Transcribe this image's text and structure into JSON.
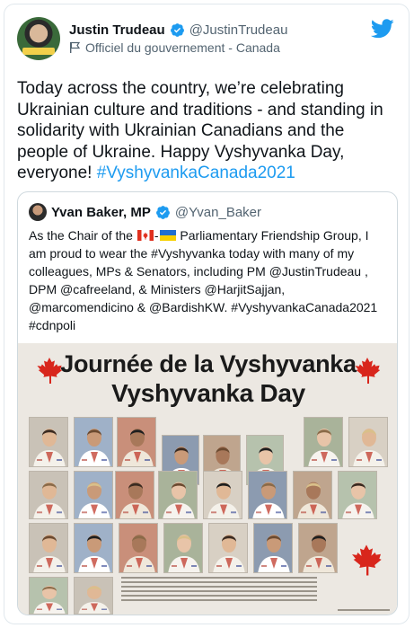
{
  "author": {
    "name": "Justin Trudeau",
    "handle": "@JustinTrudeau",
    "label": "Officiel du gouvernement - Canada"
  },
  "tweet": {
    "text": "Today across the country, we’re celebrating Ukrainian culture and traditions - and standing in solidarity with Ukrainian Canadians and the people of Ukraine. Happy Vyshyvanka Day, everyone! ",
    "hashtag": "#VyshyvankaCanada2021"
  },
  "quote": {
    "name": "Yvan Baker, MP",
    "handle": "@Yvan_Baker",
    "text_before_flags": "As the Chair of the ",
    "text_after_flags": " Parliamentary Friendship Group, I am proud to wear the #Vyshyvanka today with many of my colleagues, MPs & Senators, including PM @JustinTrudeau , DPM @cafreeland, & Ministers @HarjitSajjan, @marcomendicino & @BardishKW. #VyshyvankaCanada2021 #cdnpoli"
  },
  "poster": {
    "title_fr": "Journée de la Vyshyvanka",
    "title_en": "Vyshyvanka Day"
  },
  "icons": {
    "verified": "verified-badge-icon",
    "government": "flag-icon",
    "brand": "twitter-bird-icon"
  },
  "colors": {
    "accent": "#1d9bf0",
    "text": "#0f1419",
    "muted": "#536471",
    "border": "#cfd9de"
  }
}
